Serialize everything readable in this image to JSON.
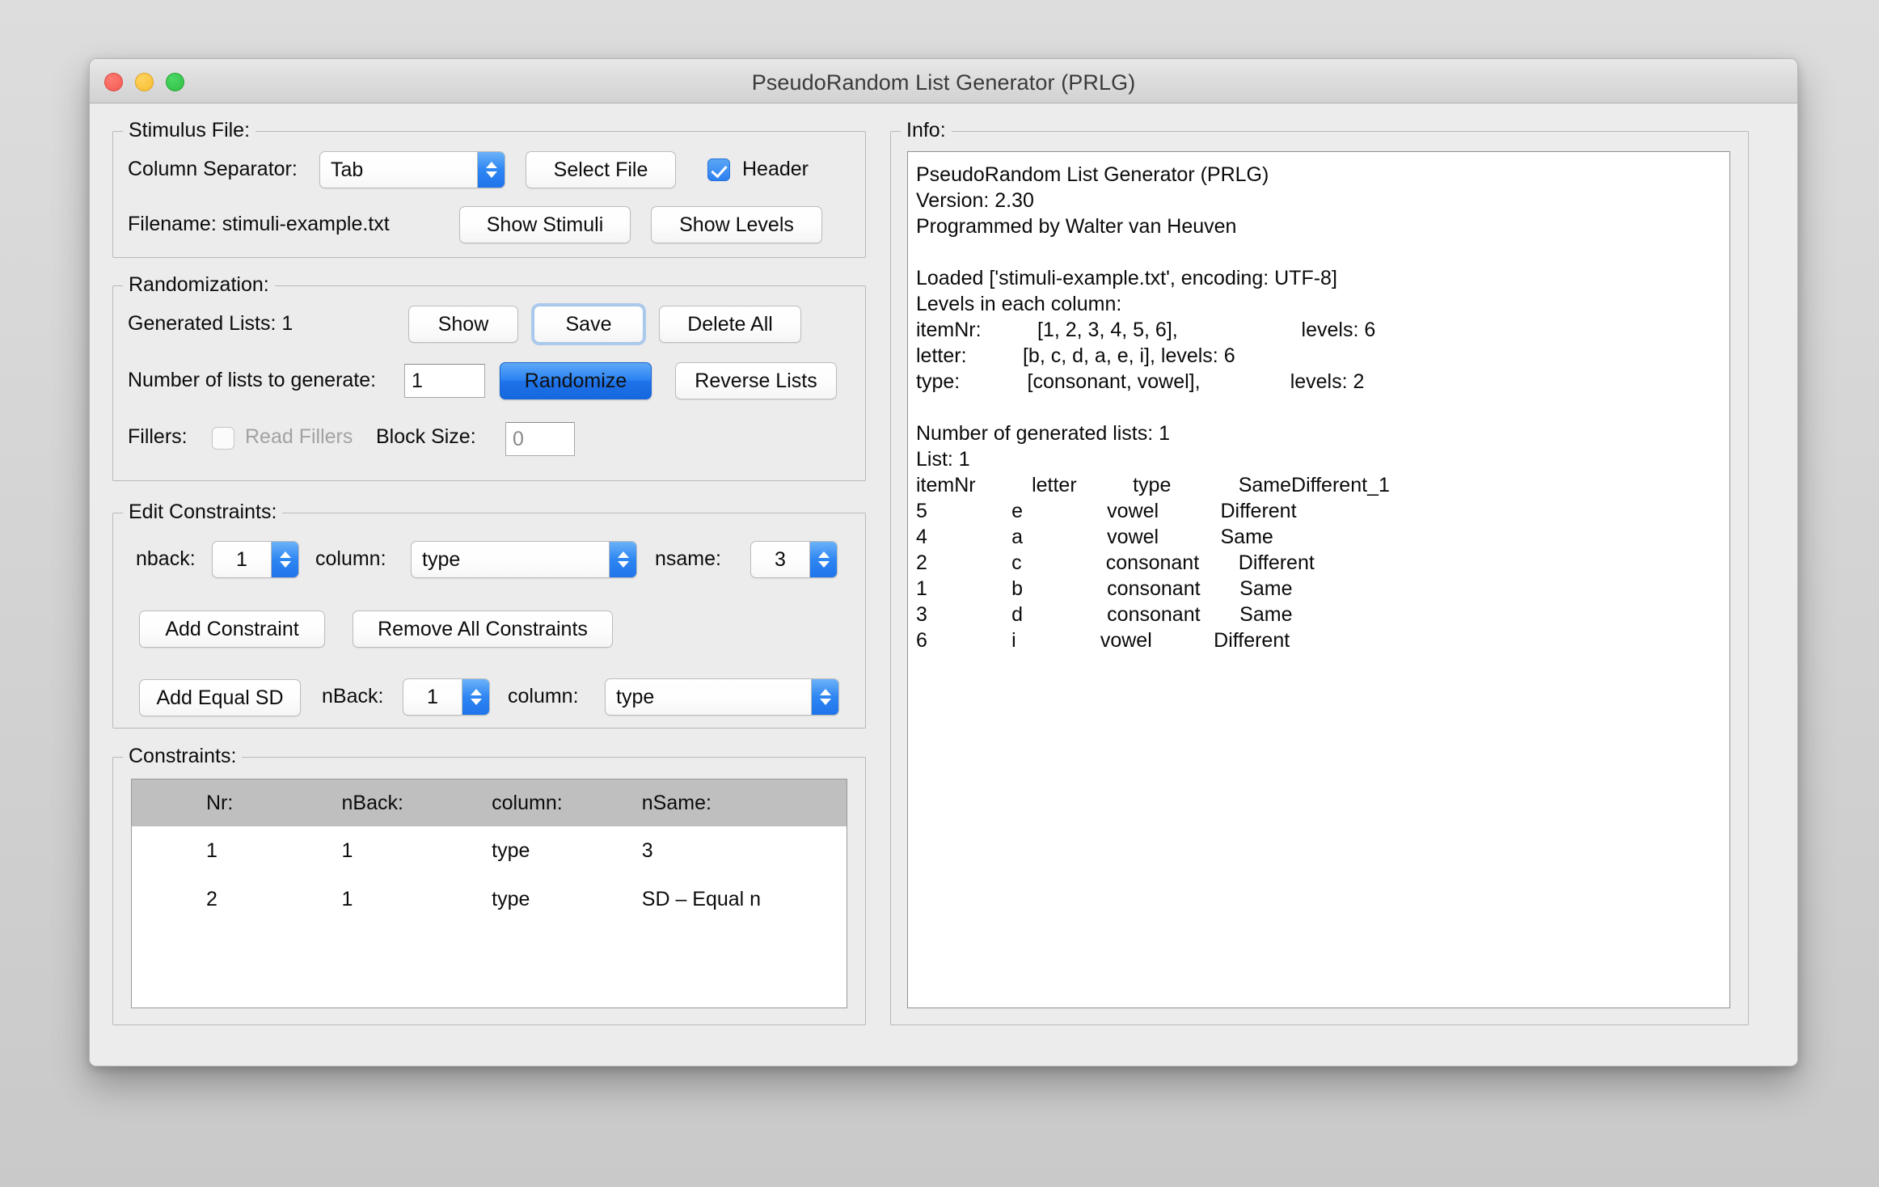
{
  "window": {
    "title": "PseudoRandom List Generator (PRLG)",
    "traffic_lights": [
      "close-icon",
      "minimize-icon",
      "zoom-icon"
    ]
  },
  "stimulus_file": {
    "legend": "Stimulus File:",
    "column_separator_label": "Column Separator:",
    "column_separator_value": "Tab",
    "select_file_button": "Select File",
    "header_checkbox_label": "Header",
    "header_checked": true,
    "filename_label": "Filename: stimuli-example.txt",
    "show_stimuli_button": "Show Stimuli",
    "show_levels_button": "Show Levels"
  },
  "randomization": {
    "legend": "Randomization:",
    "generated_lists_label": "Generated Lists:  1",
    "show_button": "Show",
    "save_button": "Save",
    "delete_all_button": "Delete All",
    "number_of_lists_label": "Number of lists to generate:",
    "number_of_lists_value": "1",
    "randomize_button": "Randomize",
    "reverse_lists_button": "Reverse Lists",
    "fillers_label": "Fillers:",
    "read_fillers_label": "Read Fillers",
    "read_fillers_checked": false,
    "block_size_label": "Block Size:",
    "block_size_value": "0"
  },
  "edit_constraints": {
    "legend": "Edit Constraints:",
    "nback_label": "nback:",
    "nback_value": "1",
    "column_label": "column:",
    "column_value": "type",
    "nsame_label": "nsame:",
    "nsame_value": "3",
    "add_constraint_button": "Add Constraint",
    "remove_all_constraints_button": "Remove All Constraints",
    "add_equal_sd_button": "Add Equal SD",
    "sd_nback_label": "nBack:",
    "sd_nback_value": "1",
    "sd_column_label": "column:",
    "sd_column_value": "type"
  },
  "constraints": {
    "legend": "Constraints:",
    "columns": [
      "Nr:",
      "nBack:",
      "column:",
      "nSame:"
    ],
    "rows": [
      [
        "1",
        "1",
        "type",
        "3"
      ],
      [
        "2",
        "1",
        "type",
        "SD – Equal n"
      ]
    ]
  },
  "info": {
    "legend": "Info:",
    "text": "PseudoRandom List Generator (PRLG)\nVersion: 2.30\nProgrammed by Walter van Heuven\n\nLoaded ['stimuli-example.txt', encoding: UTF-8]\nLevels in each column:\nitemNr:          [1, 2, 3, 4, 5, 6],                      levels: 6\nletter:          [b, c, d, a, e, i], levels: 6\ntype:            [consonant, vowel],                levels: 2\n\nNumber of generated lists: 1\nList: 1\nitemNr          letter          type            SameDifferent_1\n5               e               vowel           Different\n4               a               vowel           Same\n2               c               consonant       Different\n1               b               consonant       Same\n3               d               consonant       Same\n6               i               vowel           Different"
  },
  "colors": {
    "accent_blue": "#2d7ff0",
    "window_bg": "#ececec",
    "table_header_gray": "#bfbfbf"
  }
}
